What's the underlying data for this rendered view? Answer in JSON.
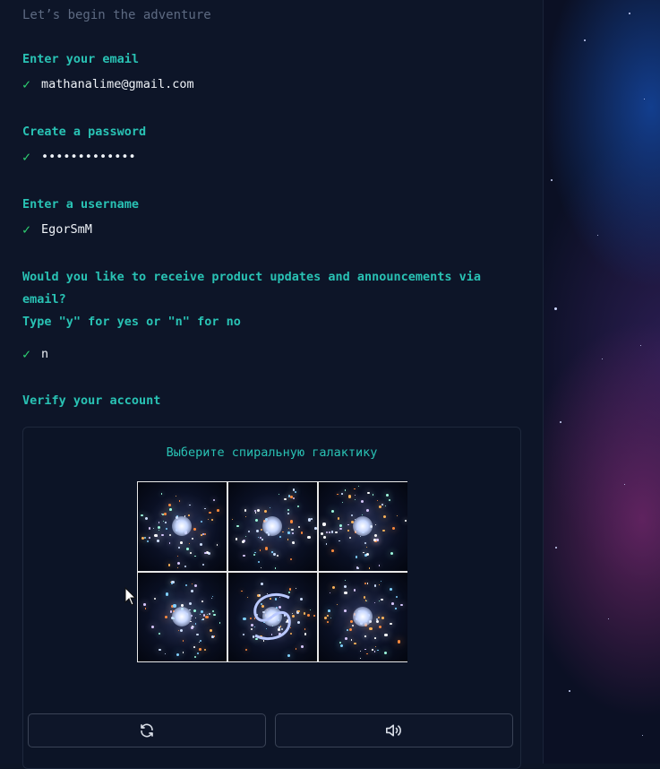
{
  "intro": "Let’s begin the adventure",
  "questions": [
    {
      "label": "Enter your email",
      "answer": "mathanalime@gmail.com"
    },
    {
      "label": "Create a password",
      "answer": "•••••••••••••"
    },
    {
      "label": "Enter a username",
      "answer": "EgorSmM"
    },
    {
      "label": "Would you like to receive product updates and announcements via email?",
      "hint": "Type \"y\" for yes or \"n\" for no",
      "answer": "n"
    }
  ],
  "verify_label": "Verify your account",
  "captcha": {
    "title": "Выберите спиральную галактику",
    "tiles": [
      "galaxy-image-1",
      "galaxy-image-2",
      "galaxy-image-3",
      "galaxy-image-4",
      "galaxy-image-5",
      "galaxy-image-6"
    ],
    "refresh_icon": "refresh-icon",
    "audio_icon": "speaker-icon"
  },
  "check_icon": "checkmark-icon",
  "colors": {
    "accent": "#29c2b4",
    "check": "#2ecf71",
    "text": "#eef2f7",
    "muted": "#5d6a82",
    "panel": "#0d1528"
  }
}
